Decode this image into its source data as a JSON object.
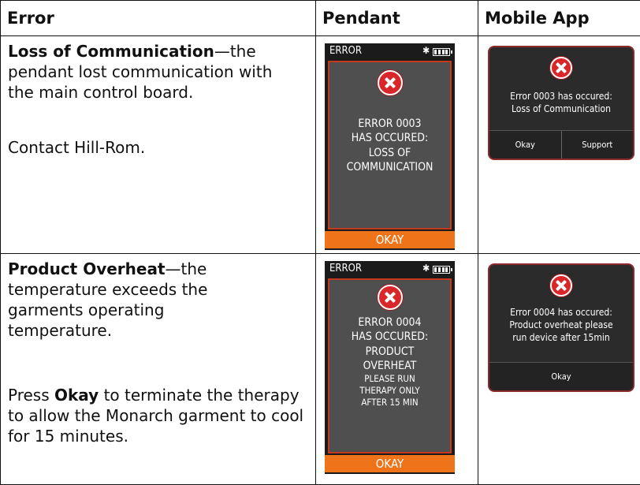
{
  "headers": {
    "error": "Error",
    "pendant": "Pendant",
    "mobile": "Mobile App"
  },
  "rows": [
    {
      "title": "Loss of Communication",
      "desc_rest": "—the pendant lost communication with the main control board.",
      "action": "Contact Hill-Rom.",
      "pendant": {
        "bar_label": "ERROR",
        "lines": [
          "ERROR 0003",
          "HAS OCCURED:",
          "LOSS OF",
          "COMMUNICATION"
        ],
        "okay": "OKAY"
      },
      "mobile": {
        "line1": "Error 0003 has occured:",
        "line2": "Loss of Communication",
        "btn1": "Okay",
        "btn2": "Support"
      }
    },
    {
      "title": "Product Overheat",
      "desc_rest": "—the temperature exceeds the garments operating temperature.",
      "action_pre": "Press ",
      "action_bold": "Okay",
      "action_post": " to terminate the therapy to allow the Monarch garment to cool for 15 minutes.",
      "pendant": {
        "bar_label": "ERROR",
        "lines": [
          "ERROR 0004",
          "HAS OCCURED:",
          "PRODUCT",
          "OVERHEAT"
        ],
        "small_lines": [
          "PLEASE RUN",
          "THERAPY ONLY",
          "AFTER 15 MIN"
        ],
        "okay": "OKAY"
      },
      "mobile": {
        "line1": "Error 0004 has occured:",
        "line2": "Product overheat please",
        "line3": "run device after 15min",
        "btn1": "Okay"
      }
    }
  ],
  "icons": {
    "error": "error-x-icon",
    "bluetooth": "bluetooth-icon",
    "battery": "battery-icon"
  },
  "colors": {
    "error_red": "#d8262a",
    "okay_orange": "#ef7419",
    "screen_gray": "#4f4f4f",
    "frame_red": "#c53a1d"
  }
}
